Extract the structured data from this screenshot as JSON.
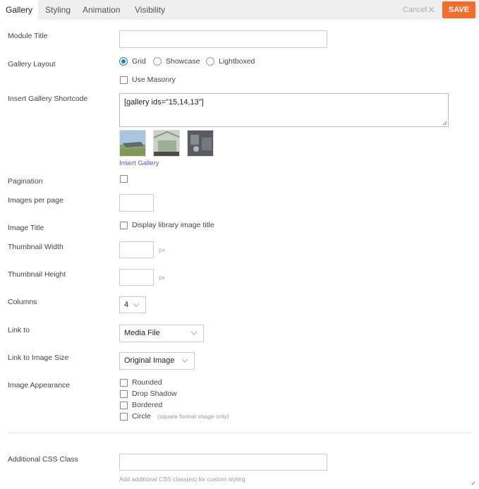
{
  "tabs": [
    "Gallery",
    "Styling",
    "Animation",
    "Visibility"
  ],
  "header": {
    "cancel_label": "Cancel",
    "save_label": "SAVE"
  },
  "fields": {
    "module_title": {
      "label": "Module Title",
      "value": ""
    },
    "gallery_layout": {
      "label": "Gallery Layout",
      "options": [
        "Grid",
        "Showcase",
        "Lightboxed"
      ],
      "selected": "Grid",
      "masonry_label": "Use Masonry"
    },
    "shortcode": {
      "label": "Insert Gallery Shortcode",
      "value": "[gallery ids=\"15,14,13\"]",
      "insert_link": "Insert Gallery",
      "thumbnails": [
        "beach-boat-thumbnail",
        "greenhouse-thumbnail",
        "interior-thumbnail"
      ]
    },
    "pagination": {
      "label": "Pagination"
    },
    "images_per_page": {
      "label": "Images per page",
      "value": ""
    },
    "image_title": {
      "label": "Image Title",
      "checkbox_label": "Display library image title"
    },
    "thumb_width": {
      "label": "Thumbnail Width",
      "unit": "px"
    },
    "thumb_height": {
      "label": "Thumbnail Height",
      "unit": "px"
    },
    "columns": {
      "label": "Columns",
      "value": "4"
    },
    "link_to": {
      "label": "Link to",
      "value": "Media File"
    },
    "link_image_size": {
      "label": "Link to Image Size",
      "value": "Original Image"
    },
    "image_appearance": {
      "label": "Image Appearance",
      "options": [
        "Rounded",
        "Drop Shadow",
        "Bordered",
        "Circle"
      ],
      "circle_note": "(square format image only)"
    },
    "css_class": {
      "label": "Additional CSS Class",
      "hint": "Add additional CSS class(es) for custom styling"
    }
  },
  "colors": {
    "accent": "#f06f2f",
    "radio": "#1e7fb8",
    "link": "#6a4fb5"
  }
}
